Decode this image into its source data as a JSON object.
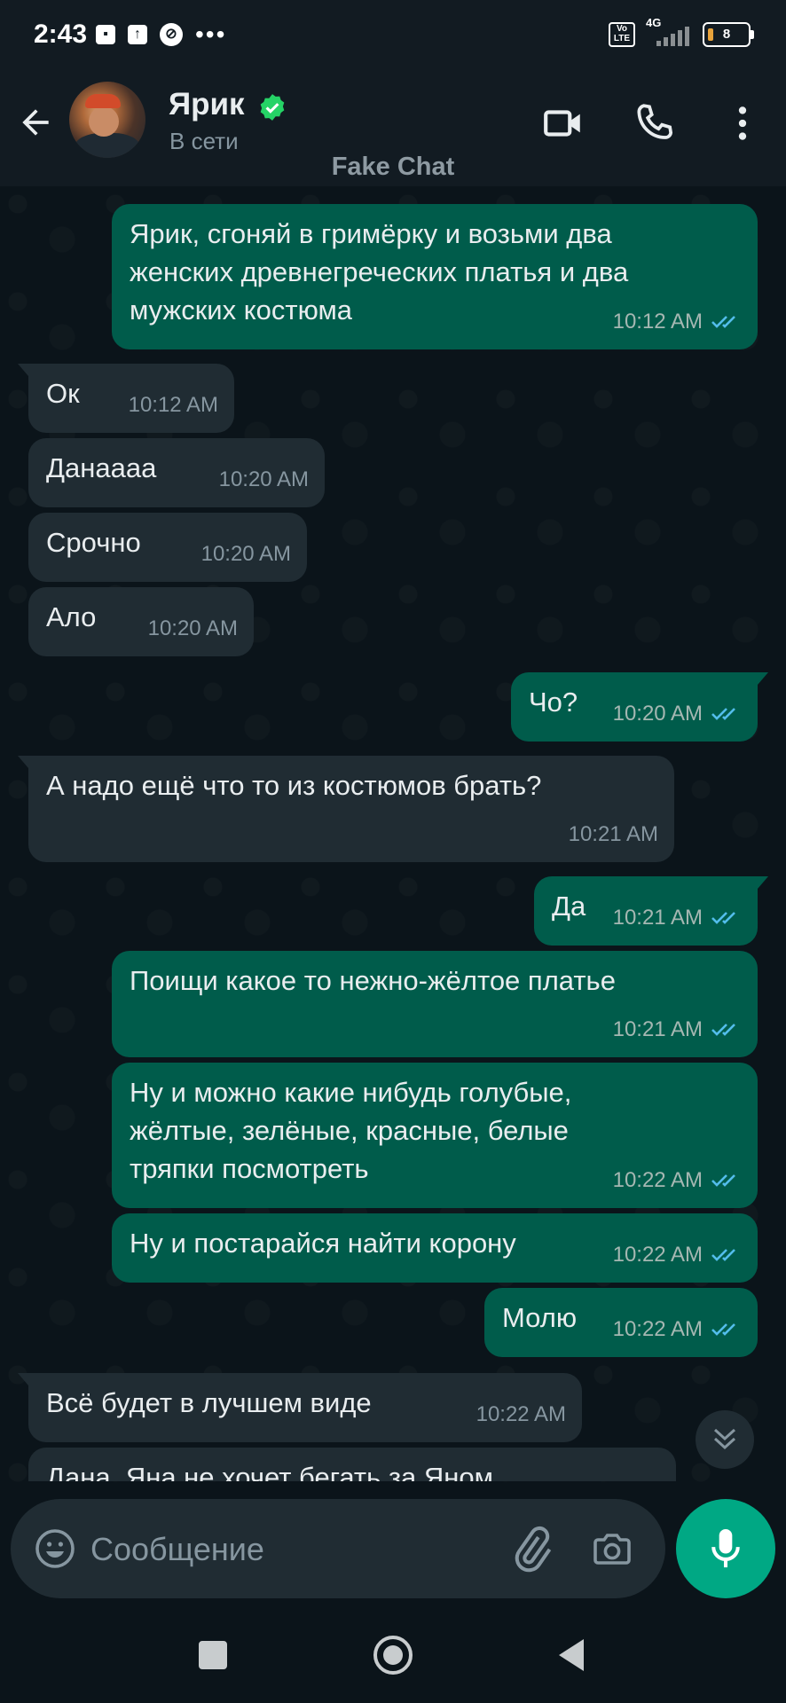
{
  "status_bar": {
    "time": "2:43",
    "network": "4G",
    "volte": "Vo LTE",
    "battery": "8",
    "overflow": "•••"
  },
  "header": {
    "contact_name": "Ярик",
    "contact_status": "В сети",
    "watermark": "Fake Chat",
    "icons": [
      "back-arrow-icon",
      "verified-badge-icon",
      "video-call-icon",
      "voice-call-icon",
      "more-vert-icon"
    ]
  },
  "messages": [
    {
      "direction": "out",
      "lines": [
        "Ярик, сгоняй в гримёрку и возьми два",
        "женских древнегреческих платья и два",
        "мужских костюма"
      ],
      "time": "10:12 AM",
      "read": true
    },
    {
      "direction": "in",
      "lines": [
        "Ок"
      ],
      "time": "10:12 AM"
    },
    {
      "direction": "in",
      "lines": [
        "Данаааа"
      ],
      "time": "10:20 AM"
    },
    {
      "direction": "in",
      "lines": [
        "Срочно"
      ],
      "time": "10:20 AM"
    },
    {
      "direction": "in",
      "lines": [
        "Ало"
      ],
      "time": "10:20 AM"
    },
    {
      "direction": "out",
      "lines": [
        "Чо?"
      ],
      "time": "10:20 AM",
      "read": true
    },
    {
      "direction": "in",
      "lines": [
        "А надо ещё что то из костюмов брать?"
      ],
      "time": "10:21 AM"
    },
    {
      "direction": "out",
      "lines": [
        "Да"
      ],
      "time": "10:21 AM",
      "read": true
    },
    {
      "direction": "out",
      "lines": [
        "Поищи какое то нежно-жёлтое платье"
      ],
      "time": "10:21 AM",
      "read": true
    },
    {
      "direction": "out",
      "lines": [
        "Ну и можно какие нибудь голубые,",
        "жёлтые, зелёные, красные, белые",
        "тряпки посмотреть"
      ],
      "time": "10:22 AM",
      "read": true
    },
    {
      "direction": "out",
      "lines": [
        "Ну и постарайся найти корону"
      ],
      "time": "10:22 AM",
      "read": true
    },
    {
      "direction": "out",
      "lines": [
        "Молю"
      ],
      "time": "10:22 AM",
      "read": true
    },
    {
      "direction": "in",
      "lines": [
        "Всё будет в лучшем виде"
      ],
      "time": "10:22 AM"
    },
    {
      "direction": "in",
      "lines": [
        "Дана, Яна не хочет бегать за Яном"
      ],
      "time": ""
    }
  ],
  "composer": {
    "placeholder": "Сообщение"
  },
  "colors": {
    "background": "#0b141a",
    "header": "#121b22",
    "bubble_out": "#005c4b",
    "bubble_in": "#202c33",
    "accent": "#00a884",
    "read_ticks": "#53bdeb"
  }
}
